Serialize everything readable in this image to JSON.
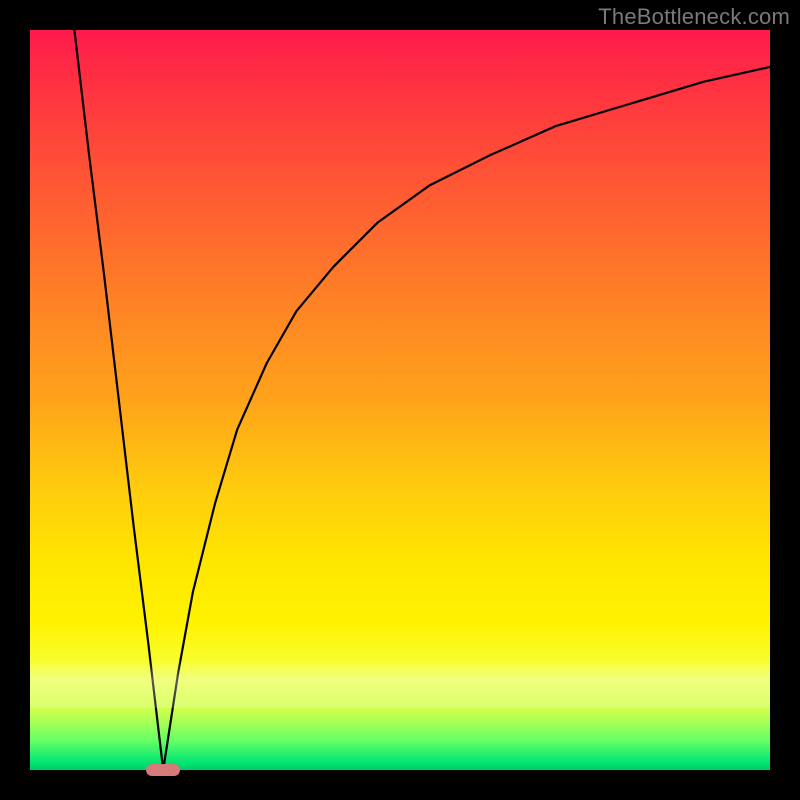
{
  "watermark": "TheBottleneck.com",
  "chart_data": {
    "type": "line",
    "title": "",
    "xlabel": "",
    "ylabel": "",
    "xlim": [
      0,
      100
    ],
    "ylim": [
      0,
      100
    ],
    "grid": false,
    "legend": false,
    "vertex_x": 18,
    "vertex_y": 0,
    "marker": {
      "color": "#d67a7a",
      "shape": "pill"
    },
    "background_gradient": {
      "top": "#ff1a4d",
      "mid": "#ffe600",
      "bottom": "#00cc66"
    },
    "series": [
      {
        "name": "left-branch",
        "x": [
          6,
          8,
          10,
          12,
          14,
          16,
          18
        ],
        "y": [
          100,
          83,
          67,
          50,
          33,
          17,
          0
        ]
      },
      {
        "name": "right-branch",
        "x": [
          18,
          20,
          22,
          25,
          28,
          32,
          36,
          41,
          47,
          54,
          62,
          71,
          81,
          91,
          100
        ],
        "y": [
          0,
          13,
          24,
          36,
          46,
          55,
          62,
          68,
          74,
          79,
          83,
          87,
          90,
          93,
          95
        ]
      }
    ]
  }
}
